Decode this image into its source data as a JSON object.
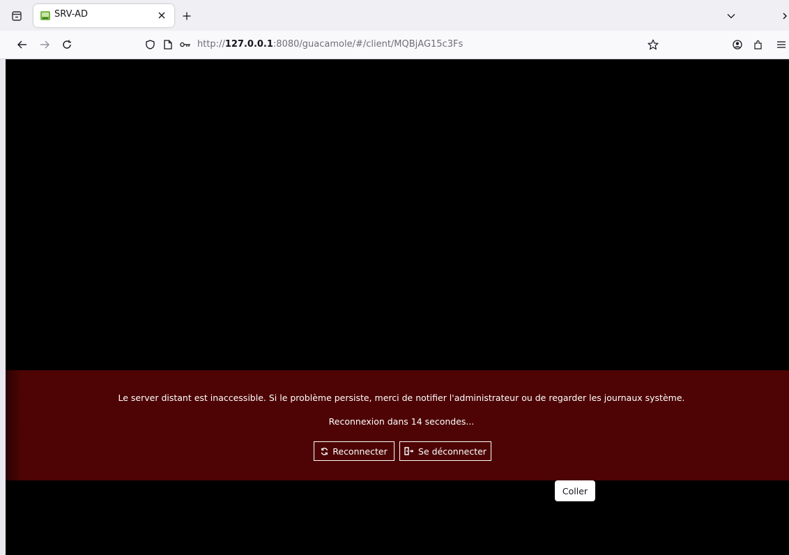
{
  "browser": {
    "tab": {
      "title": "SRV-AD",
      "close_glyph": "×",
      "favicon": "guacamole-favicon"
    },
    "new_tab_glyph": "+",
    "url": {
      "prefix": "http://",
      "host": "127.0.0.1",
      "rest": ":8080/guacamole/#/client/MQBjAG15c3Fs"
    }
  },
  "error": {
    "message": "Le server distant est inaccessible. Si le problème persiste, merci de notifier l'administrateur ou de regarder les journaux système.",
    "countdown": "Reconnexion dans 14 secondes...",
    "reconnect_label": "Reconnecter",
    "disconnect_label": "Se déconnecter"
  },
  "paste_menu": {
    "label": "Coller"
  },
  "colors": {
    "banner": "#4e0404",
    "background": "#000000",
    "tabbar": "#f0f0f4"
  }
}
